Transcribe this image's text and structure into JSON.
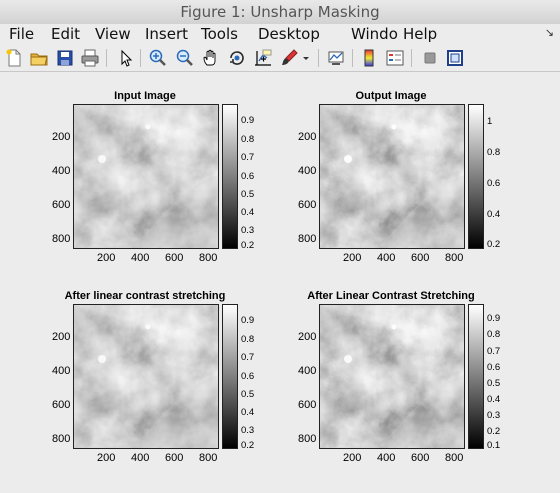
{
  "window": {
    "title": "Figure 1: Unsharp Masking"
  },
  "menu": {
    "items": [
      "File",
      "Edit",
      "View",
      "Insert",
      "Tools",
      "Desktop",
      "Windo",
      "Help"
    ]
  },
  "toolbar": {
    "icons": [
      "new-figure-icon",
      "open-file-icon",
      "save-icon",
      "print-icon",
      "pointer-icon",
      "zoom-in-icon",
      "zoom-out-icon",
      "pan-hand-icon",
      "rotate-3d-icon",
      "data-cursor-icon",
      "brush-icon",
      "brush-dropdown-icon",
      "link-plot-icon",
      "colorbar-icon",
      "legend-icon",
      "hide-plot-tools-icon",
      "show-plot-tools-icon"
    ]
  },
  "plots": [
    {
      "title": "Input Image",
      "xticks": [
        "200",
        "400",
        "600",
        "800"
      ],
      "yticks": [
        "200",
        "400",
        "600",
        "800"
      ],
      "colorbar": [
        "0.9",
        "0.8",
        "0.7",
        "0.6",
        "0.5",
        "0.4",
        "0.3",
        "0.2"
      ]
    },
    {
      "title": "Output Image",
      "xticks": [
        "200",
        "400",
        "600",
        "800"
      ],
      "yticks": [
        "200",
        "400",
        "600",
        "800"
      ],
      "colorbar": [
        "1",
        "0.8",
        "0.6",
        "0.4",
        "0.2"
      ]
    },
    {
      "title": "After linear contrast stretching",
      "xticks": [
        "200",
        "400",
        "600",
        "800"
      ],
      "yticks": [
        "200",
        "400",
        "600",
        "800"
      ],
      "colorbar": [
        "0.9",
        "0.8",
        "0.7",
        "0.6",
        "0.5",
        "0.4",
        "0.3",
        "0.2"
      ]
    },
    {
      "title": "After Linear Contrast Stretching",
      "xticks": [
        "200",
        "400",
        "600",
        "800"
      ],
      "yticks": [
        "200",
        "400",
        "600",
        "800"
      ],
      "colorbar": [
        "0.9",
        "0.8",
        "0.7",
        "0.6",
        "0.5",
        "0.4",
        "0.3",
        "0.2",
        "0.1"
      ]
    }
  ]
}
